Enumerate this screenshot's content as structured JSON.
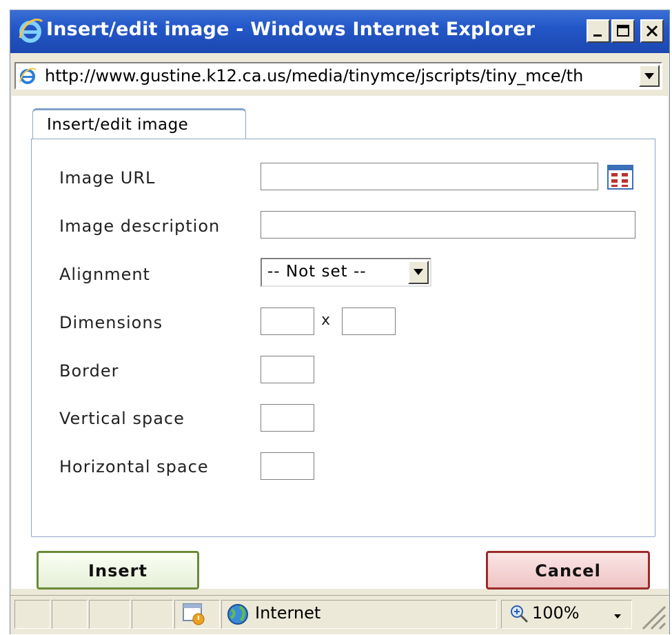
{
  "window": {
    "title": "Insert/edit image - Windows Internet Explorer",
    "address": "http://www.gustine.k12.ca.us/media/tinymce/jscripts/tiny_mce/th"
  },
  "dialog": {
    "tab_label": "Insert/edit image",
    "fields": {
      "image_url_label": "Image URL",
      "image_description_label": "Image description",
      "alignment_label": "Alignment",
      "alignment_value": "-- Not set --",
      "dimensions_label": "Dimensions",
      "dimensions_separator": "x",
      "border_label": "Border",
      "vertical_space_label": "Vertical space",
      "horizontal_space_label": "Horizontal space"
    },
    "insert_label": "Insert",
    "cancel_label": "Cancel"
  },
  "statusbar": {
    "zone": "Internet",
    "zoom": "100%"
  },
  "colors": {
    "titlebar": "#2357c8",
    "insert_border": "#6a8a38",
    "cancel_border": "#9c2a2a"
  }
}
